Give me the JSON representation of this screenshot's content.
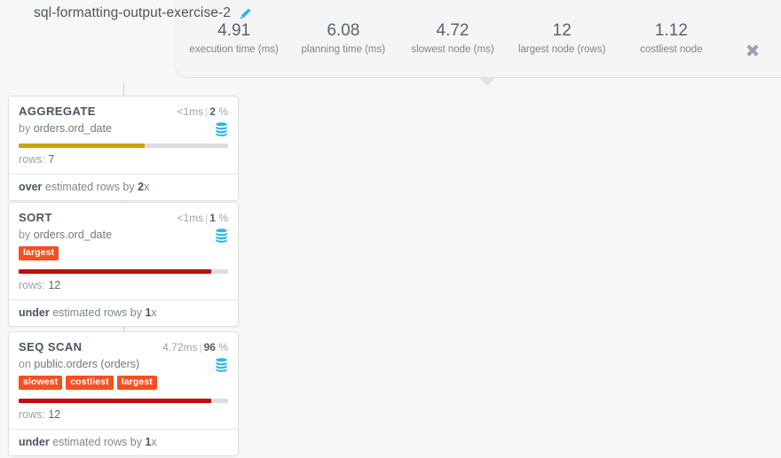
{
  "header": {
    "title": "sql-formatting-output-exercise-2",
    "edit_icon": "pencil-icon",
    "close_icon": "close-icon"
  },
  "stats": [
    {
      "value": "4.91",
      "label": "execution time (ms)"
    },
    {
      "value": "6.08",
      "label": "planning time (ms)"
    },
    {
      "value": "4.72",
      "label": "slowest node (ms)"
    },
    {
      "value": "12",
      "label": "largest node (rows)"
    },
    {
      "value": "1.12",
      "label": "costliest node"
    }
  ],
  "colors": {
    "badge": "#f74f20",
    "bar_warning": "#c9a400",
    "bar_danger": "#c00d0d",
    "track": "#dddddd",
    "accent_icon": "#29b6e8"
  },
  "nodes": [
    {
      "type": "AGGREGATE",
      "time": "<1ms",
      "separator": "|",
      "percent": "2",
      "percent_unit": "%",
      "sub_prefix": "by",
      "sub_value": "orders.ord_date",
      "badges": [],
      "bar_color": "#c9a400",
      "bar_percent": 60,
      "rows_label": "rows:",
      "rows_value": "7",
      "estimate_kind": "over",
      "estimate_text": "estimated rows by",
      "estimate_factor": "2",
      "estimate_suffix": "x",
      "icon": "database-icon"
    },
    {
      "type": "SORT",
      "time": "<1ms",
      "separator": "|",
      "percent": "1",
      "percent_unit": "%",
      "sub_prefix": "by",
      "sub_value": "orders.ord_date",
      "badges": [
        "largest"
      ],
      "bar_color": "#c00d0d",
      "bar_percent": 92,
      "rows_label": "rows:",
      "rows_value": "12",
      "estimate_kind": "under",
      "estimate_text": "estimated rows by",
      "estimate_factor": "1",
      "estimate_suffix": "x",
      "icon": "database-icon"
    },
    {
      "type": "SEQ SCAN",
      "time": "4.72ms",
      "separator": "|",
      "percent": "96",
      "percent_unit": "%",
      "sub_prefix": "on",
      "sub_value": "public.orders (orders)",
      "badges": [
        "slowest",
        "costliest",
        "largest"
      ],
      "bar_color": "#c00d0d",
      "bar_percent": 92,
      "rows_label": "rows:",
      "rows_value": "12",
      "estimate_kind": "under",
      "estimate_text": "estimated rows by",
      "estimate_factor": "1",
      "estimate_suffix": "x",
      "icon": "database-icon"
    }
  ]
}
